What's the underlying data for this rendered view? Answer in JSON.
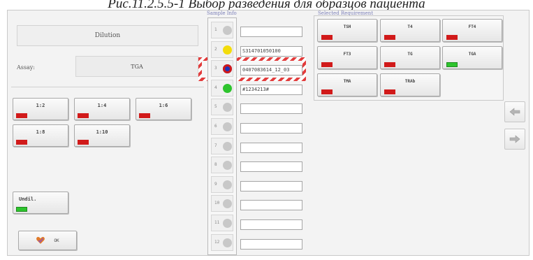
{
  "caption": "Рис.11.2.5.5-1 Выбор разведения для образцов пациента",
  "colors": {
    "red": "#d11a1a",
    "green": "#2dc42d",
    "yellow": "#f3dc0b",
    "blue_dot": "#2234b8",
    "gray_dot": "#c8c8c8",
    "title_blue": "#7b7fb8"
  },
  "dilution": {
    "header": "Dilution",
    "assay_label": "Assay:",
    "assay_value": "TGA",
    "buttons": [
      {
        "label": "1:2",
        "status": "red"
      },
      {
        "label": "1:4",
        "status": "red"
      },
      {
        "label": "1:6",
        "status": "red"
      },
      {
        "label": "1:8",
        "status": "red"
      },
      {
        "label": "1:10",
        "status": "red"
      },
      {
        "label": "Undil.",
        "status": "green"
      }
    ],
    "ok_label": "OK",
    "ok_icon": "heart-check-icon"
  },
  "sample_info": {
    "title": "Sample Info",
    "slots": [
      {
        "num": "1",
        "dot": "gray",
        "value": ""
      },
      {
        "num": "2",
        "dot": "yellow",
        "value": "S314701050100"
      },
      {
        "num": "3",
        "dot": "blue",
        "value": "0407083614_12_03"
      },
      {
        "num": "4",
        "dot": "green",
        "value": "#1234213#"
      },
      {
        "num": "5",
        "dot": "gray",
        "value": ""
      },
      {
        "num": "6",
        "dot": "gray",
        "value": ""
      },
      {
        "num": "7",
        "dot": "gray",
        "value": ""
      },
      {
        "num": "8",
        "dot": "gray",
        "value": ""
      },
      {
        "num": "9",
        "dot": "gray",
        "value": ""
      },
      {
        "num": "10",
        "dot": "gray",
        "value": ""
      },
      {
        "num": "11",
        "dot": "gray",
        "value": ""
      },
      {
        "num": "12",
        "dot": "gray",
        "value": ""
      }
    ]
  },
  "requirement": {
    "title": "Selected Requirement",
    "tests": [
      {
        "label": "TSH",
        "status": "red"
      },
      {
        "label": "T4",
        "status": "red"
      },
      {
        "label": "FT4",
        "status": "red"
      },
      {
        "label": "FT3",
        "status": "red"
      },
      {
        "label": "TG",
        "status": "red"
      },
      {
        "label": "TGA",
        "status": "green"
      },
      {
        "label": "TMA",
        "status": "red"
      },
      {
        "label": "TRAb",
        "status": "red"
      }
    ]
  },
  "nav": {
    "left_icon": "arrow-left-icon",
    "right_icon": "arrow-right-icon"
  }
}
